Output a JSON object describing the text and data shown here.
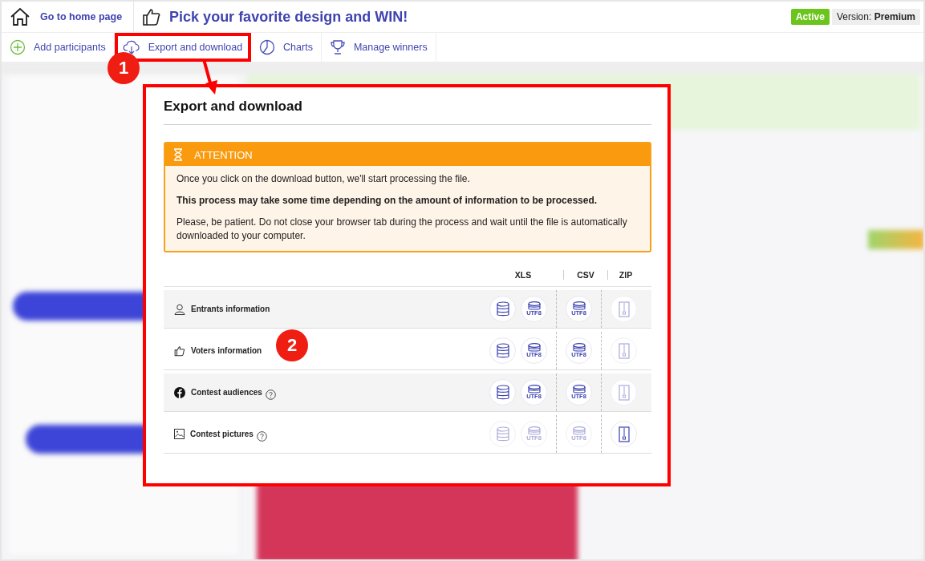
{
  "header": {
    "home_link": "Go to home page",
    "title": "Pick your favorite design and WIN!",
    "status_badge": "Active",
    "version_label": "Version:",
    "version_value": "Premium"
  },
  "toolbar": [
    {
      "label": "Add participants",
      "kind": "plus",
      "highlighted": false
    },
    {
      "label": "Export and download",
      "kind": "cloud",
      "highlighted": true
    },
    {
      "label": "Charts",
      "kind": "pie",
      "highlighted": false
    },
    {
      "label": "Manage winners",
      "kind": "trophy",
      "highlighted": false
    }
  ],
  "annotations": [
    {
      "label": "1"
    },
    {
      "label": "2"
    }
  ],
  "modal": {
    "title": "Export and download",
    "attention": {
      "heading": "ATTENTION",
      "paragraphs": [
        {
          "text": "Once you click on the download button, we'll start processing the file.",
          "bold": false
        },
        {
          "text": "This process may take some time depending on the amount of information to be processed.",
          "bold": true
        },
        {
          "text": "Please, be patient. Do not close your browser tab during the process and wait until the file is automatically downloaded to your computer.",
          "bold": false
        }
      ]
    },
    "columns": [
      "XLS",
      "CSV",
      "ZIP"
    ],
    "rows": [
      {
        "label": "Entrants information",
        "kind": "person",
        "help": false,
        "buttons": [
          {
            "kind": "database",
            "disabled": false
          },
          {
            "kind": "database-utf8",
            "label": "UTF8",
            "disabled": false
          },
          {
            "kind": "database-utf8",
            "label": "UTF8",
            "disabled": false
          },
          {
            "kind": "zip",
            "disabled": true
          }
        ]
      },
      {
        "label": "Voters information",
        "kind": "thumb",
        "help": false,
        "buttons": [
          {
            "kind": "database",
            "disabled": false
          },
          {
            "kind": "database-utf8",
            "label": "UTF8",
            "disabled": false
          },
          {
            "kind": "database-utf8",
            "label": "UTF8",
            "disabled": false
          },
          {
            "kind": "zip",
            "disabled": true
          }
        ]
      },
      {
        "label": "Contest audiences",
        "kind": "facebook",
        "help": true,
        "buttons": [
          {
            "kind": "database",
            "disabled": false
          },
          {
            "kind": "database-utf8",
            "label": "UTF8",
            "disabled": false
          },
          {
            "kind": "database-utf8",
            "label": "UTF8",
            "disabled": false
          },
          {
            "kind": "zip",
            "disabled": true
          }
        ]
      },
      {
        "label": "Contest pictures",
        "kind": "image",
        "help": true,
        "buttons": [
          {
            "kind": "database",
            "disabled": true
          },
          {
            "kind": "database-utf8",
            "label": "UTF8",
            "disabled": true
          },
          {
            "kind": "database-utf8",
            "label": "UTF8",
            "disabled": true
          },
          {
            "kind": "zip",
            "disabled": false
          }
        ]
      }
    ]
  }
}
